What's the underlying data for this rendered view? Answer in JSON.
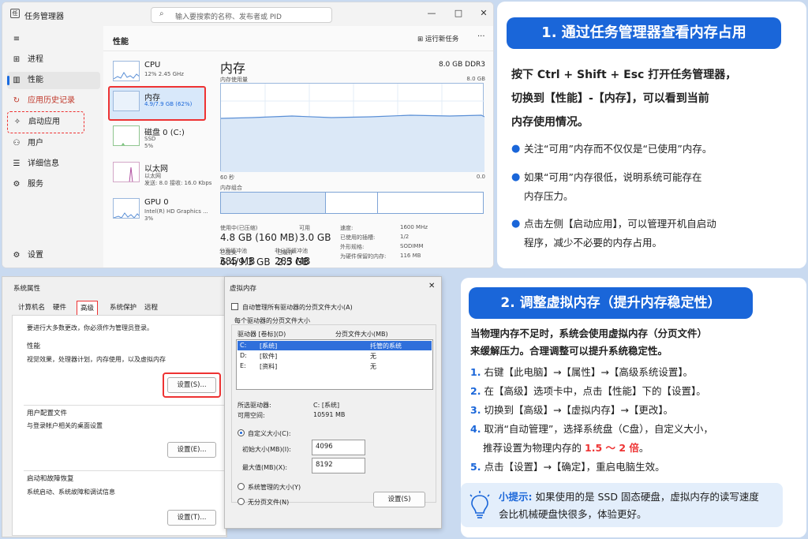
{
  "task_manager": {
    "title": "任务管理器",
    "app_icon_label": "任",
    "search_placeholder": "输入要搜索的名称、发布者或 PID",
    "nav": [
      {
        "icon": "hamburger-icon",
        "glyph": "≡",
        "label": ""
      },
      {
        "icon": "processes-icon",
        "glyph": "⊞",
        "label": "进程"
      },
      {
        "icon": "performance-icon",
        "glyph": "▥",
        "label": "性能"
      },
      {
        "icon": "history-icon",
        "glyph": "↻",
        "label": "应用历史记录"
      },
      {
        "icon": "startup-icon",
        "glyph": "✧",
        "label": "启动应用"
      },
      {
        "icon": "users-icon",
        "glyph": "⚇",
        "label": "用户"
      },
      {
        "icon": "details-icon",
        "glyph": "☰",
        "label": "详细信息"
      },
      {
        "icon": "services-icon",
        "glyph": "⚙",
        "label": "服务"
      }
    ],
    "settings_label": "设置",
    "section_title": "性能",
    "run_new_task": "运行新任务",
    "devices": [
      {
        "name": "CPU",
        "sub1": "12% 2.45 GHz",
        "sub2": ""
      },
      {
        "name": "内存",
        "sub1": "4.9/7.9 GB (62%)",
        "sub2": ""
      },
      {
        "name": "磁盘 0 (C:)",
        "sub1": "SSD",
        "sub2": "5%"
      },
      {
        "name": "以太网",
        "sub1": "以太网",
        "sub2": "发送: 8.0 接收: 16.0 Kbps"
      },
      {
        "name": "GPU 0",
        "sub1": "Intel(R) HD Graphics ...",
        "sub2": "3%"
      }
    ],
    "memory": {
      "title": "内存",
      "capacity": "8.0 GB DDR3",
      "usage_label": "内存使用量",
      "usage_max": "8.0 GB",
      "axis_left": "60 秒",
      "axis_right": "0.0",
      "composition_label": "内存组合",
      "in_use_label": "使用中(已压缩)",
      "in_use_value": "4.8 GB (160 MB)",
      "available_label": "可用",
      "available_value": "3.0 GB",
      "committed_label": "已提交",
      "committed_value": "6.4/9.3 GB",
      "cached_label": "已缓存",
      "cached_value": "2.5 GB",
      "paged_label": "分页缓冲池",
      "paged_value": "385 MB",
      "nonpaged_label": "非分页缓冲池",
      "nonpaged_value": "283 MB",
      "specs": [
        {
          "k": "速度:",
          "v": "1600 MHz"
        },
        {
          "k": "已使用的插槽:",
          "v": "1/2"
        },
        {
          "k": "外形规格:",
          "v": "SODIMM"
        },
        {
          "k": "为硬件保留的内存:",
          "v": "116 MB"
        }
      ]
    }
  },
  "callout1": {
    "title": "1. 通过任务管理器查看内存占用",
    "intro": [
      "按下 Ctrl + Shift + Esc 打开任务管理器，",
      "切换到【性能】-【内存】，可以看到当前",
      "内存使用情况。"
    ],
    "bullets": [
      [
        "关注“可用”内存而不仅仅是“已使用”内存。"
      ],
      [
        "如果“可用”内存很低，说明系统可能存在",
        "内存压力。"
      ],
      [
        "点击左侧【启动应用】，可以管理开机自启动",
        "程序，减少不必要的内存占用。"
      ]
    ]
  },
  "system_properties": {
    "title": "系统属性",
    "tabs": [
      "计算机名",
      "硬件",
      "高级",
      "系统保护",
      "远程"
    ],
    "admin_note": "要进行大多数更改，你必须作为管理员登录。",
    "perf_title": "性能",
    "perf_desc": "视觉效果，处理器计划，内存使用，以及虚拟内存",
    "settings_btn": "设置(S)...",
    "profile_title": "用户配置文件",
    "profile_desc": "与登录帐户相关的桌面设置",
    "profile_btn": "设置(E)...",
    "startup_title": "启动和故障恢复",
    "startup_desc": "系统启动、系统故障和调试信息",
    "startup_btn": "设置(T)..."
  },
  "virtual_memory": {
    "title": "虚拟内存",
    "auto_manage": "自动管理所有驱动器的分页文件大小(A)",
    "group_title": "每个驱动器的分页文件大小",
    "col_drive": "驱动器 [卷标](D)",
    "col_size": "分页文件大小(MB)",
    "drives": [
      {
        "drive": "C:",
        "label": "[系统]",
        "size": "托管的系统"
      },
      {
        "drive": "D:",
        "label": "[软件]",
        "size": "无"
      },
      {
        "drive": "E:",
        "label": "[资料]",
        "size": "无"
      }
    ],
    "selected_drive_label": "所选驱动器:",
    "selected_drive_value": "C:  [系统]",
    "free_space_label": "可用空间:",
    "free_space_value": "10591 MB",
    "custom_size": "自定义大小(C):",
    "initial_label": "初始大小(MB)(I):",
    "initial_value": "4096",
    "max_label": "最大值(MB)(X):",
    "max_value": "8192",
    "system_managed": "系统管理的大小(Y)",
    "no_paging": "无分页文件(N)",
    "set_btn": "设置(S)"
  },
  "callout2": {
    "title": "2. 调整虚拟内存（提升内存稳定性）",
    "intro": [
      "当物理内存不足时，系统会使用虚拟内存（分页文件）",
      "来缓解压力。合理调整可以提升系统稳定性。"
    ],
    "steps": [
      {
        "n": "1.",
        "t": "右键【此电脑】→【属性】→【高级系统设置】。"
      },
      {
        "n": "2.",
        "t": "在【高级】选项卡中，点击【性能】下的【设置】。"
      },
      {
        "n": "3.",
        "t": "切换到【高级】→【虚拟内存】→【更改】。"
      },
      {
        "n": "4.",
        "t": "取消“自动管理”，选择系统盘（C盘），自定义大小，"
      }
    ],
    "step4_line2_a": "推荐设置为物理内存的",
    "step4_highlight": "1.5 ～ 2 倍",
    "step4_line2_b": "。",
    "step5": {
      "n": "5.",
      "t": "点击【设置】→【确定】，重启电脑生效。"
    },
    "tip_label": "小提示:",
    "tip_line1": "如果使用的是 SSD 固态硬盘，虚拟内存的读写速度",
    "tip_line2": "会比机械硬盘快很多，体验更好。"
  },
  "colors": {
    "accent": "#1a66d9",
    "highlight": "#e33333",
    "graph_line": "#5a8fd6",
    "graph_fill": "#dbe8f7"
  }
}
